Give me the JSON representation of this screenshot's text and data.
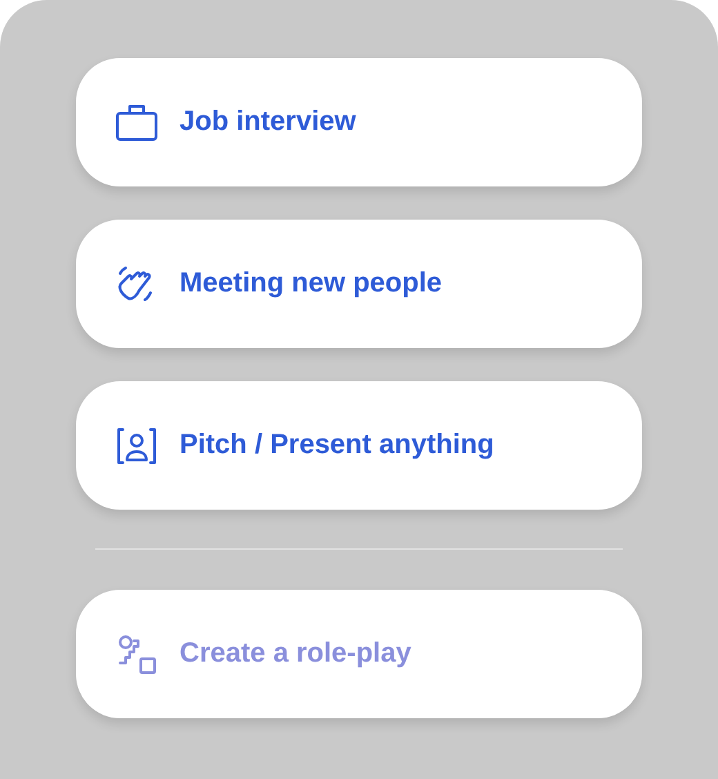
{
  "options": [
    {
      "label": "Job interview",
      "kind": "briefcase",
      "muted": false
    },
    {
      "label": "Meeting new people",
      "kind": "wave",
      "muted": false
    },
    {
      "label": "Pitch / Present anything",
      "kind": "presenter",
      "muted": false
    }
  ],
  "custom": {
    "label": "Create a role-play",
    "kind": "roleplay",
    "muted": true
  }
}
